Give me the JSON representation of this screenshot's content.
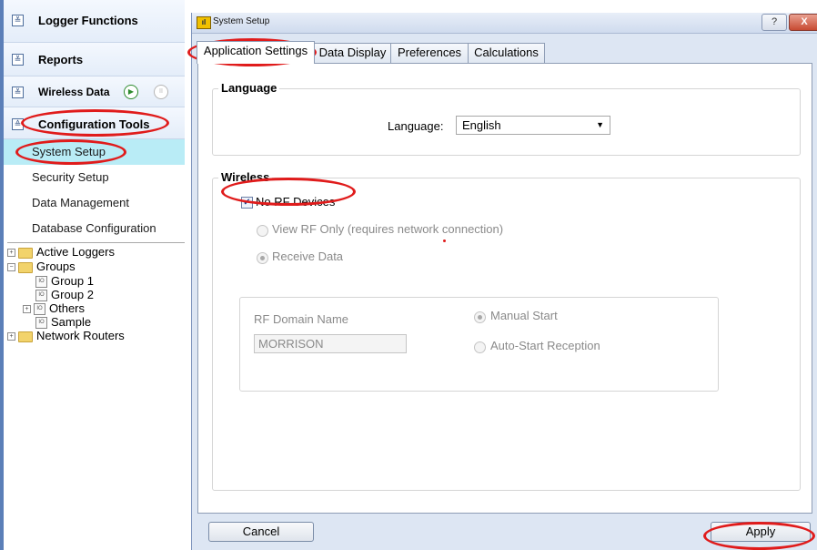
{
  "nav": {
    "logger_functions": "Logger Functions",
    "reports": "Reports",
    "wireless_data": "Wireless Data",
    "configuration_tools": "Configuration Tools",
    "items": [
      "System Setup",
      "Security Setup",
      "Data Management",
      "Database Configuration"
    ],
    "selected_item": "System Setup"
  },
  "tree": {
    "nodes": [
      "Active Loggers",
      "Groups",
      "Group 1",
      "Group 2",
      "Others",
      "Sample",
      "Network Routers"
    ]
  },
  "dialog": {
    "title": "System Setup",
    "help_glyph": "?",
    "close_glyph": "X",
    "tabs": [
      "Application Settings",
      "Data Display",
      "Preferences",
      "Calculations"
    ],
    "active_tab": "Application Settings"
  },
  "language": {
    "group_title": "Language",
    "label": "Language:",
    "value": "English"
  },
  "wireless": {
    "group_title": "Wireless",
    "no_rf_devices_label": "No RF Devices",
    "no_rf_devices_checked": true,
    "view_rf_only_label": "View RF Only (requires network connection)",
    "receive_data_label": "Receive Data",
    "rf_domain_name_label": "RF Domain Name",
    "rf_domain_name_value": "MORRISON",
    "manual_start_label": "Manual Start",
    "auto_start_label": "Auto-Start Reception"
  },
  "buttons": {
    "cancel": "Cancel",
    "apply": "Apply"
  },
  "colors": {
    "annotation_red": "#e01b1b",
    "selected_row": "#b9ecf6",
    "dialog_background": "#dde6f3"
  }
}
